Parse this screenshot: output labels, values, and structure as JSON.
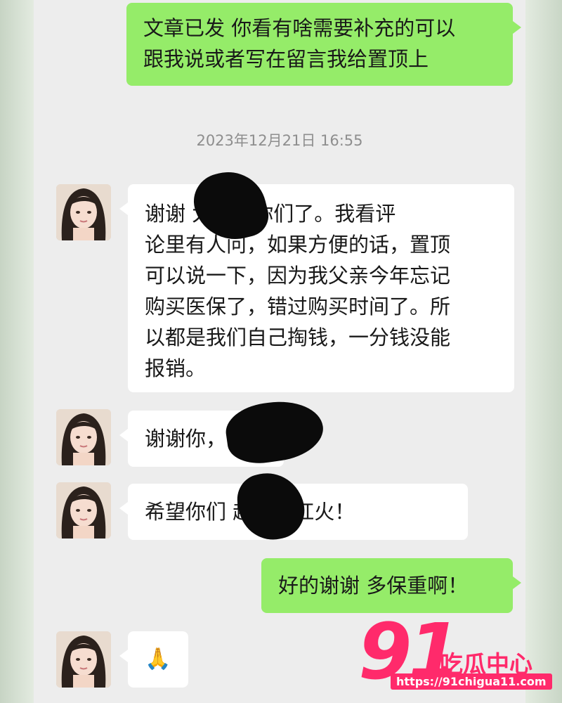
{
  "messages": [
    {
      "side": "out",
      "text": "文章已发 你看有啥需要补充的可以\n跟我说或者写在留言我给置顶上"
    },
    {
      "side": "in",
      "text": "谢谢 太麻烦你们了。我看评\n论里有人问，如果方便的话，置顶\n可以说一下，因为我父亲今年忘记\n购买医保了，错过购买时间了。所\n以都是我们自己掏钱，一分钱没能\n报销。"
    },
    {
      "side": "in",
      "text": "谢谢你，"
    },
    {
      "side": "in",
      "text": "希望你们 越来越红火！"
    },
    {
      "side": "out",
      "text": "好的谢谢 多保重啊！"
    },
    {
      "side": "in",
      "text": "🙏"
    }
  ],
  "timestamp": "2023年12月21日 16:55",
  "watermark": {
    "number": "91",
    "title": "吃瓜中心",
    "url": "https://91chigua11.com"
  },
  "colors": {
    "outgoing_bubble": "#95ec69",
    "incoming_bubble": "#ffffff",
    "chat_background": "#ededed",
    "watermark": "#ff2a6b"
  }
}
